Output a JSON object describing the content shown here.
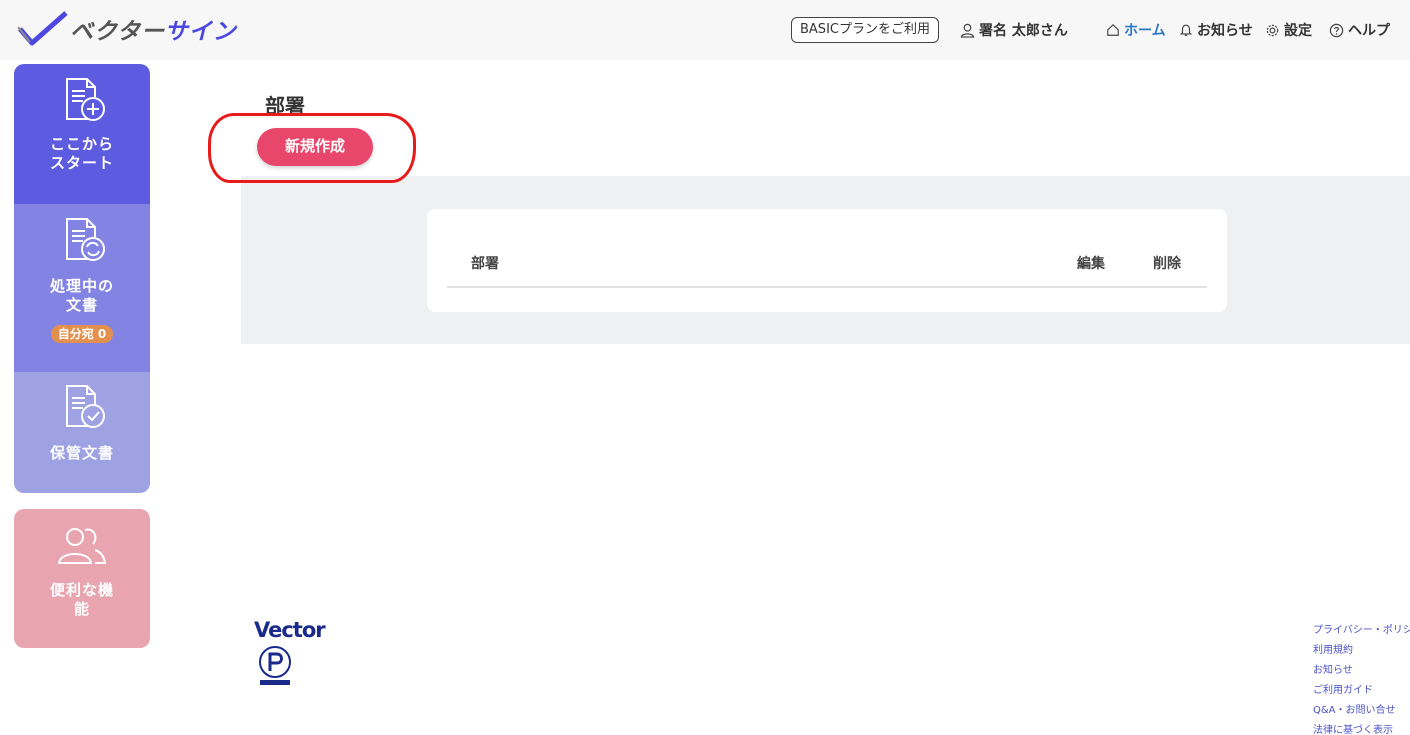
{
  "header": {
    "logo_part1": "ベクター",
    "logo_part2": "サイン",
    "plan_badge": "BASICプランをご利用",
    "user_name": "署名 太郎さん",
    "nav": {
      "home": "ホーム",
      "notifications": "お知らせ",
      "settings": "設定",
      "help": "ヘルプ"
    }
  },
  "sidebar": {
    "start_line1": "ここから",
    "start_line2": "スタート",
    "process_line1": "処理中の",
    "process_line2": "文書",
    "self_badge": "自分宛 0",
    "archive": "保管文書",
    "feature_line1": "便利な機",
    "feature_line2": "能"
  },
  "main": {
    "title": "部署",
    "new_button": "新規作成",
    "table": {
      "col_department": "部署",
      "col_edit": "編集",
      "col_delete": "削除"
    }
  },
  "footer": {
    "brand": "Vector",
    "links": [
      "プライバシー・ポリシー",
      "利用規約",
      "お知らせ",
      "ご利用ガイド",
      "Q&A・お問い合せ",
      "法律に基づく表示"
    ]
  },
  "colors": {
    "accent_primary": "#5d5be0",
    "button_new": "#e8466a",
    "highlight": "#e81b1b",
    "nav_active": "#2a78c6"
  }
}
